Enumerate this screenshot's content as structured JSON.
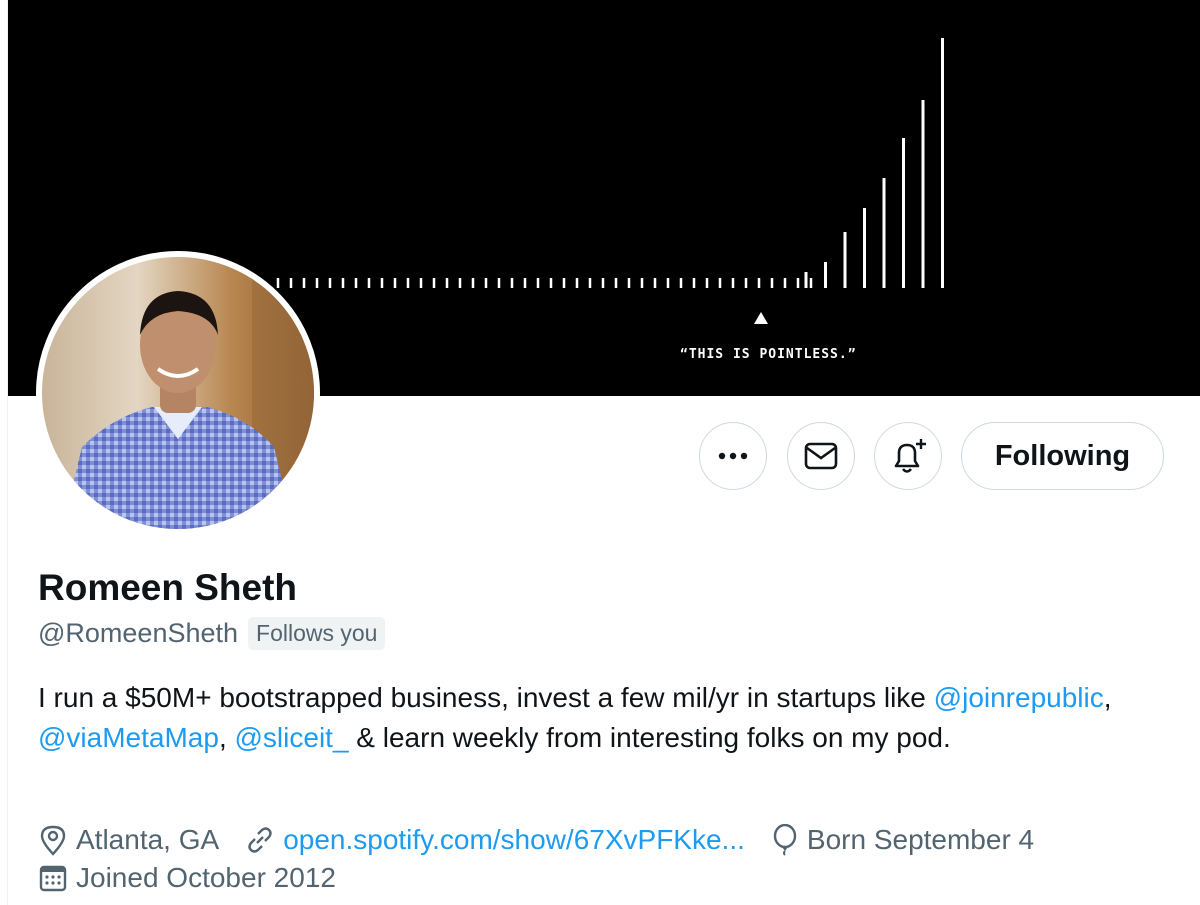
{
  "banner": {
    "caption": "“THIS IS POINTLESS.”"
  },
  "profile": {
    "name": "Romeen Sheth",
    "handle": "@RomeenSheth",
    "follows_you": "Follows you"
  },
  "actions": {
    "more_icon": "more-horizontal-icon",
    "message_icon": "envelope-icon",
    "notify_icon": "bell-plus-icon",
    "following_label": "Following"
  },
  "bio": {
    "line1": "I run a $50M+ bootstrapped business, invest a few mil/yr in startups like",
    "mention1": "@joinrepublic",
    "sep1": ", ",
    "mention2": "@viaMetaMap",
    "sep2": ", ",
    "mention3": "@sliceit_",
    "rest": " & learn weekly from interesting folks on my pod."
  },
  "meta": {
    "location": "Atlanta, GA",
    "url": "open.spotify.com/show/67XvPFKke...",
    "birthday": "Born September 4",
    "joined": "Joined October 2012"
  },
  "colors": {
    "link": "#1d9bf0",
    "secondary_text": "#536471",
    "border": "#cfd9de"
  }
}
